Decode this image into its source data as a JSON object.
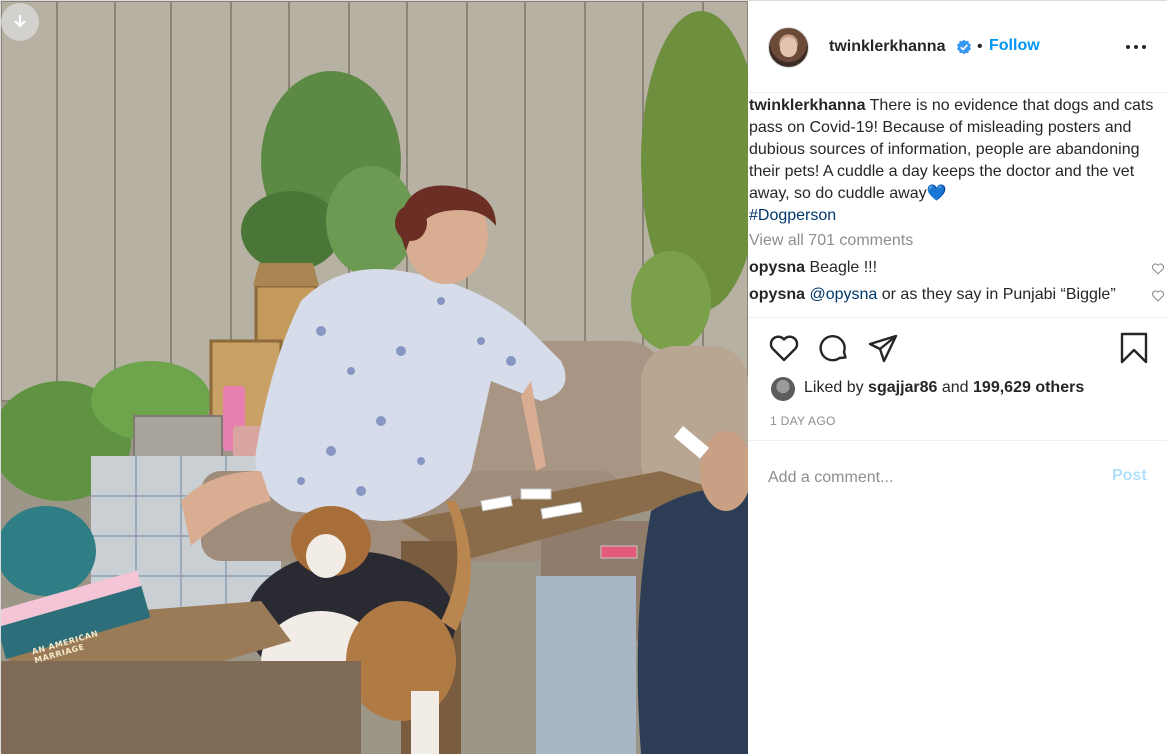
{
  "post": {
    "author": {
      "username": "twinklerkhanna",
      "verified_icon": "verified-badge-icon",
      "separator": "•",
      "follow_label": "Follow",
      "more_icon": "more-options-icon"
    },
    "caption": {
      "username": "twinklerkhanna",
      "text": "There is no evidence that dogs and cats pass on Covid-19! Because of misleading posters and dubious sources of information, people are abandoning their pets! A cuddle a day keeps the doctor and the vet away, so do cuddle away",
      "emoji": "💙",
      "hashtag": "#Dogperson"
    },
    "view_all_comments": "View all 701 comments",
    "comments": [
      {
        "username": "opysna",
        "mention": "",
        "text": "Beagle !!!"
      },
      {
        "username": "opysna",
        "mention": "@opysna",
        "text": " or as they say in Punjabi “Biggle”"
      }
    ],
    "actions": {
      "like_icon": "heart-icon",
      "comment_icon": "comment-icon",
      "share_icon": "share-icon",
      "save_icon": "bookmark-icon"
    },
    "likes": {
      "prefix": "Liked by ",
      "first_user": "sgajjar86",
      "middle": " and ",
      "others": "199,629 others"
    },
    "time_ago": "1 DAY AGO",
    "add_comment": {
      "placeholder": "Add a comment...",
      "post_label": "Post"
    },
    "photo": {
      "book_title": "AN AMERICAN MARRIAGE"
    }
  }
}
